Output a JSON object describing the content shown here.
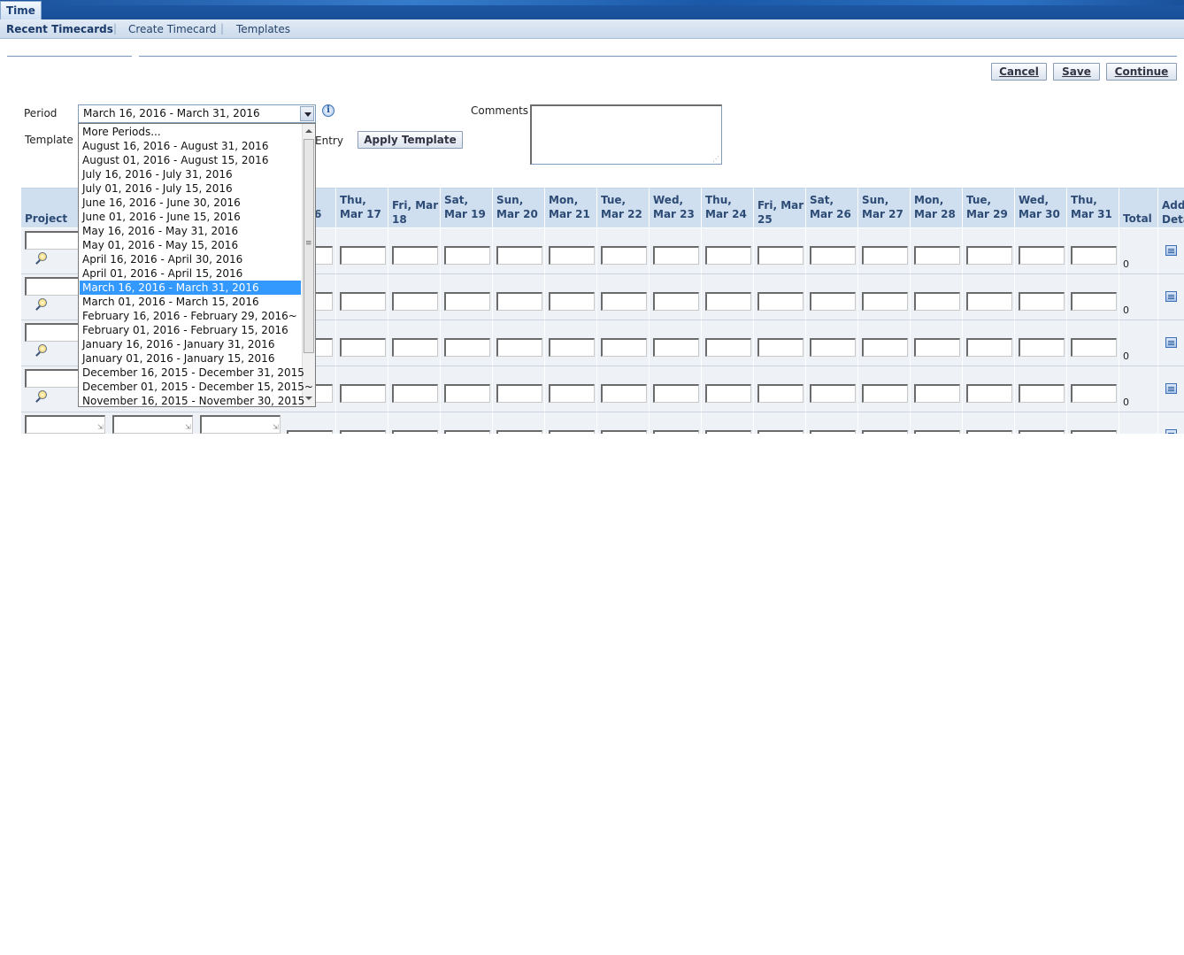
{
  "nav": {
    "main_tab": "Time",
    "sub_tabs": [
      "Recent Timecards",
      "Create Timecard",
      "Templates"
    ],
    "separator": "|"
  },
  "toolbar": {
    "cancel": "Cancel",
    "save": "Save",
    "continue": "Continue"
  },
  "form": {
    "period_label": "Period",
    "period_value": "March 16, 2016 - March 31, 2016",
    "template_label": "Template",
    "entry_label_fragment": "Entry",
    "apply_template": "Apply Template",
    "comments_label": "Comments",
    "comments_value": ""
  },
  "period_options": [
    "More Periods...",
    "August 16, 2016 - August 31, 2016",
    "August 01, 2016 - August 15, 2016",
    "July 16, 2016 - July 31, 2016",
    "July 01, 2016 - July 15, 2016",
    "June 16, 2016 - June 30, 2016",
    "June 01, 2016 - June 15, 2016",
    "May 16, 2016 - May 31, 2016",
    "May 01, 2016 - May 15, 2016",
    "April 16, 2016 - April 30, 2016",
    "April 01, 2016 - April 15, 2016",
    "March 16, 2016 - March 31, 2016",
    "March 01, 2016 - March 15, 2016",
    "February 16, 2016 - February 29, 2016~",
    "February 01, 2016 - February 15, 2016",
    "January 16, 2016 - January 31, 2016",
    "January 01, 2016 - January 15, 2016",
    "December 16, 2015 - December 31, 2015",
    "December 01, 2015 - December 15, 2015~",
    "November 16, 2015 - November 30, 2015"
  ],
  "period_selected_index": 11,
  "grid": {
    "first_header": "Project",
    "partial_day_header": "6",
    "day_headers": [
      [
        "Thu,",
        "Mar 17"
      ],
      [
        "Fri, Mar",
        "18"
      ],
      [
        "Sat,",
        "Mar 19"
      ],
      [
        "Sun,",
        "Mar 20"
      ],
      [
        "Mon,",
        "Mar 21"
      ],
      [
        "Tue,",
        "Mar 22"
      ],
      [
        "Wed,",
        "Mar 23"
      ],
      [
        "Thu,",
        "Mar 24"
      ],
      [
        "Fri, Mar",
        "25"
      ],
      [
        "Sat,",
        "Mar 26"
      ],
      [
        "Sun,",
        "Mar 27"
      ],
      [
        "Mon,",
        "Mar 28"
      ],
      [
        "Tue,",
        "Mar 29"
      ],
      [
        "Wed,",
        "Mar 30"
      ],
      [
        "Thu,",
        "Mar 31"
      ]
    ],
    "total_header": "Total",
    "detail_header": [
      "Add",
      "Deta"
    ],
    "row_totals": [
      "0",
      "0",
      "0",
      "0"
    ]
  }
}
